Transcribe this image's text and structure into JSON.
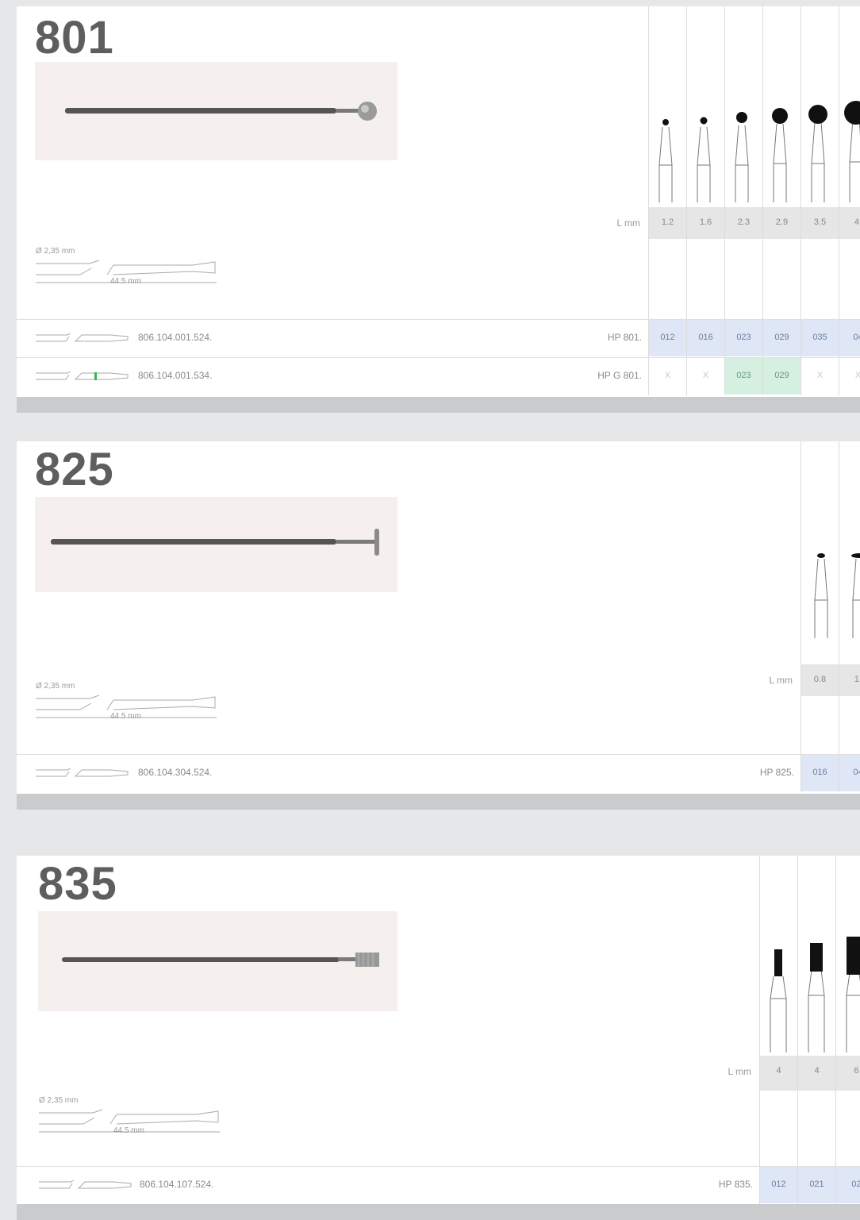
{
  "cards": [
    {
      "model": "801",
      "shank_diameter": "Ø 2,35 mm",
      "length": "44.5 mm",
      "lmm_label": "L mm",
      "lmm_values": [
        "1.2",
        "1.6",
        "2.3",
        "2.9",
        "3.5",
        "4."
      ],
      "rows": [
        {
          "code": "806.104.001.524.",
          "hp": "HP 801.",
          "green_band": false,
          "cells": [
            {
              "text": "012",
              "style": "blue"
            },
            {
              "text": "016",
              "style": "blue"
            },
            {
              "text": "023",
              "style": "blue"
            },
            {
              "text": "029",
              "style": "blue"
            },
            {
              "text": "035",
              "style": "blue"
            },
            {
              "text": "04",
              "style": "blue"
            }
          ]
        },
        {
          "code": "806.104.001.534.",
          "hp": "HP G 801.",
          "green_band": true,
          "cells": [
            {
              "text": "X",
              "style": "x"
            },
            {
              "text": "X",
              "style": "x"
            },
            {
              "text": "023",
              "style": "green"
            },
            {
              "text": "029",
              "style": "green"
            },
            {
              "text": "X",
              "style": "x"
            },
            {
              "text": "X",
              "style": "x"
            }
          ]
        }
      ],
      "head_shape": "ball"
    },
    {
      "model": "825",
      "shank_diameter": "Ø 2,35 mm",
      "length": "44.5 mm",
      "lmm_label": "L mm",
      "lmm_values": [
        "0.8",
        "1."
      ],
      "rows": [
        {
          "code": "806.104.304.524.",
          "hp": "HP 825.",
          "green_band": false,
          "cells": [
            {
              "text": "016",
              "style": "blue"
            },
            {
              "text": "04",
              "style": "blue"
            }
          ]
        }
      ],
      "head_shape": "wheel"
    },
    {
      "model": "835",
      "shank_diameter": "Ø 2,35 mm",
      "length": "44.5 mm",
      "lmm_label": "L mm",
      "lmm_values": [
        "4",
        "4",
        "6"
      ],
      "rows": [
        {
          "code": "806.104.107.524.",
          "hp": "HP 835.",
          "green_band": false,
          "cells": [
            {
              "text": "012",
              "style": "blue"
            },
            {
              "text": "021",
              "style": "blue"
            },
            {
              "text": "02",
              "style": "blue"
            }
          ]
        }
      ],
      "head_shape": "cylinder"
    }
  ]
}
